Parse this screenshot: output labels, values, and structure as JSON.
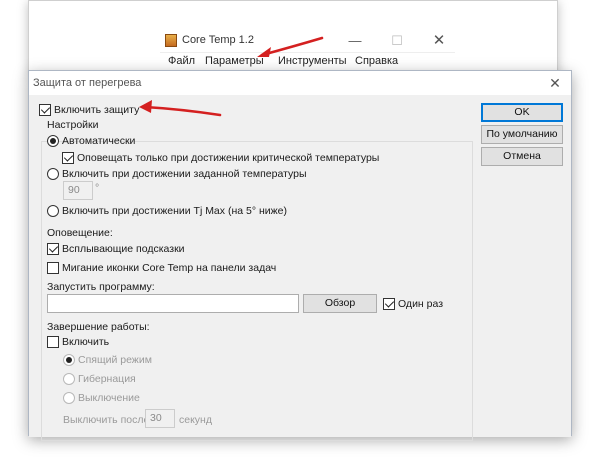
{
  "core_temp": {
    "title": "Core Temp 1.2",
    "menu": [
      "Файл",
      "Параметры",
      "Инструменты",
      "Справка"
    ],
    "controls": {
      "minimize": "—",
      "maximize": "☐",
      "close": "✕"
    }
  },
  "dialog": {
    "title": "Защита от перегрева",
    "close": "✕",
    "enable_protection": "Включить защиту",
    "settings_group": "Настройки",
    "auto": "Автоматически",
    "notify_critical": "Оповещать только при достижении критической температуры",
    "on_set_temp": "Включить при достижении заданной температуры",
    "temp_value": "90",
    "temp_unit": "°",
    "on_tjmax": "Включить при достижении Tj Max (на 5° ниже)",
    "notification_label": "Оповещение:",
    "popups": "Всплывающие подсказки",
    "blink_icon": "Мигание иконки Core Temp на панели задач",
    "run_program_label": "Запустить программу:",
    "program_path": "",
    "browse": "Обзор",
    "run_once": "Один раз",
    "shutdown_label": "Завершение работы:",
    "shutdown_enable": "Включить",
    "sleep": "Спящий режим",
    "hibernate": "Гибернация",
    "poweroff": "Выключение",
    "turn_off_after": "Выключить после",
    "seconds_value": "30",
    "seconds_unit": "секунд",
    "buttons": {
      "ok": "OK",
      "defaults": "По умолчанию",
      "cancel": "Отмена"
    }
  },
  "colors": {
    "arrow": "#d42020",
    "accent": "#0078d7"
  }
}
